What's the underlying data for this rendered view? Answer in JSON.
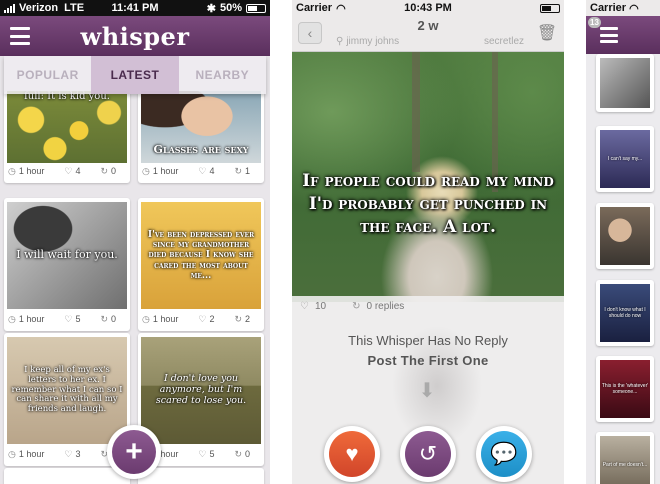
{
  "screen1": {
    "status": {
      "carrier": "Verizon",
      "network": "LTE",
      "time": "11:41 PM",
      "battery": "50%"
    },
    "app_title": "whisper",
    "tabs": [
      {
        "label": "POPULAR"
      },
      {
        "label": "LATEST",
        "active": true
      },
      {
        "label": "NEARBY"
      }
    ],
    "cards": [
      {
        "caption": "full: It is kid you.",
        "time": "1 hour",
        "hearts": "4",
        "replies": "0"
      },
      {
        "caption": "Glasses are sexy",
        "time": "1 hour",
        "hearts": "4",
        "replies": "1"
      },
      {
        "caption": "I will wait for you.",
        "time": "1 hour",
        "hearts": "5",
        "replies": "0"
      },
      {
        "caption": "I've been depressed ever since my grandmother died because I know she cared the most about me...",
        "time": "1 hour",
        "hearts": "2",
        "replies": "2"
      },
      {
        "caption": "I keep all of my ex's letters to her ex. I remember what I can so I can share it with all my friends and laugh.",
        "time": "1 hour",
        "hearts": "3",
        "replies": "0"
      },
      {
        "caption": "I don't love you anymore, but I'm scared to lose you.",
        "time": "1 hour",
        "hearts": "5",
        "replies": "0"
      }
    ],
    "fab_label": "+"
  },
  "screen2": {
    "status": {
      "carrier": "Carrier",
      "time": "10:43 PM"
    },
    "time_ago": "2 w",
    "location": "jimmy johns",
    "category": "secretlez",
    "whisper_text": "If people could read my mind I'd probably get punched in the face. A lot.",
    "hearts": "10",
    "replies_label": "0 replies",
    "no_reply_text": "This Whisper Has No Reply",
    "post_first_text": "Post The First One"
  },
  "screen3": {
    "status": {
      "carrier": "Carrier"
    },
    "badge": "13",
    "thumbs": [
      {
        "caption": ""
      },
      {
        "caption": "I can't say my..."
      },
      {
        "caption": ""
      },
      {
        "caption": "I don't know what I should do now"
      },
      {
        "caption": "This is the 'whatever' someone..."
      },
      {
        "caption": "Part of me doesn't..."
      }
    ]
  },
  "colors": {
    "brand_purple": "#6b3b6f",
    "heart_orange": "#e35a32",
    "reply_blue": "#2aa0da"
  },
  "icons": {
    "menu": "hamburger-icon",
    "plus": "plus-icon",
    "back": "back-chevron-icon",
    "trash": "trash-icon",
    "location": "location-pin-icon",
    "heart": "heart-icon",
    "rewhisper": "rewhisper-icon",
    "reply": "chat-bubble-icon",
    "clock": "clock-icon",
    "down": "down-arrow-icon"
  }
}
